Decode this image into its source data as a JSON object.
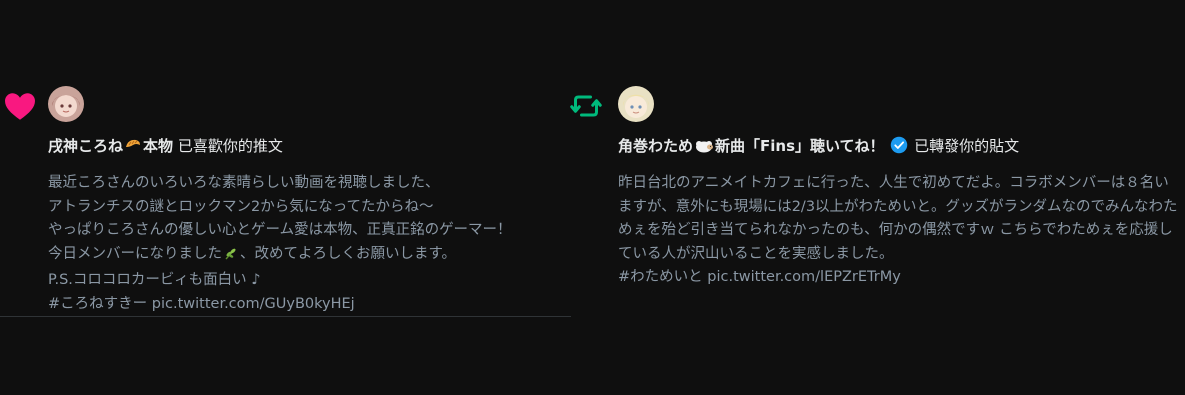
{
  "colors": {
    "background": "#0f0f0f",
    "like": "#f91880",
    "retweet": "#00ba7c",
    "verified": "#1d9bf0",
    "text_primary": "#e7e9ea",
    "text_secondary": "#8b98a5"
  },
  "notifications": [
    {
      "type": "like",
      "icon": "heart-icon",
      "user_name": "戌神ころね",
      "user_name_suffix": "本物",
      "name_emoji": "croissant-emoji",
      "action_text": "已喜歡你的推文",
      "body_lines": [
        "最近ころさんのいろいろな素晴らしい動画を視聴しました、",
        "アトランチスの謎とロックマン2から気になってたからね～",
        "やっぱりころさんの優しい心とゲーム愛は本物、正真正銘のゲーマー！",
        "今日メンバーになりました",
        "、改めてよろしくお願いします。",
        "P.S.コロコロカービィも面白い ♪"
      ],
      "hashtag": "#ころねすきー",
      "link": "pic.twitter.com/GUyB0kyHEj"
    },
    {
      "type": "retweet",
      "icon": "retweet-icon",
      "user_name": "角巻わため",
      "user_name_suffix": "新曲「Fins」聴いてね！",
      "name_emoji": "sheep-emoji",
      "verified": true,
      "action_text": "已轉發你的貼文",
      "body": "昨日台北のアニメイトカフェに行った、人生で初めてだよ。コラボメンバーは８名いますが、意外にも現場には2/3以上がわためいと。グッズがランダムなのでみんなわためぇを殆ど引き当てられなかったのも、何かの偶然ですｗ こちらでわためぇを応援している人が沢山いることを実感しました。",
      "hashtag": "#わためいと",
      "link": "pic.twitter.com/lEPZrETrMy"
    }
  ]
}
